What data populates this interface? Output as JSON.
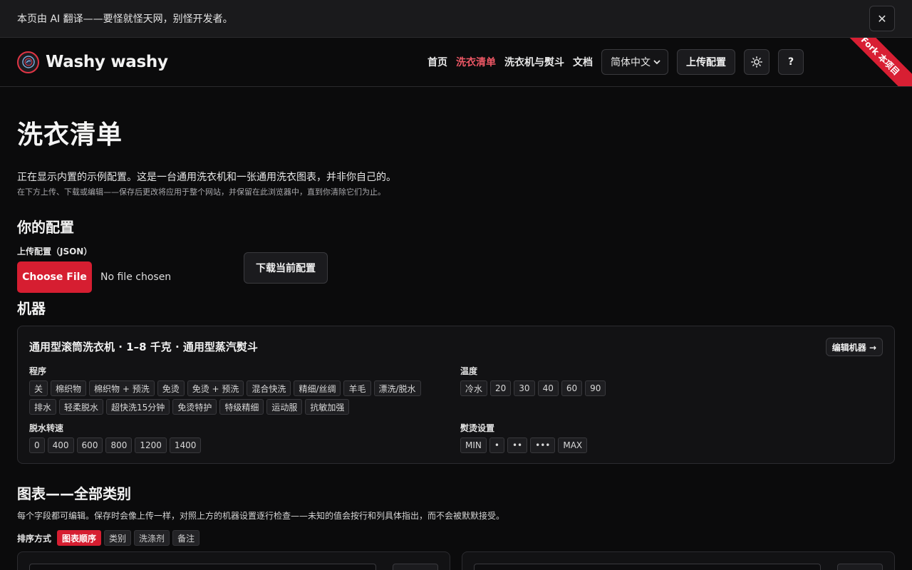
{
  "banner": {
    "text": "本页由 AI 翻译——要怪就怪天网，别怪开发者。",
    "close": "✕"
  },
  "nav": {
    "brand": "Washy washy",
    "links": [
      "首页",
      "洗衣清单",
      "洗衣机与熨斗",
      "文档"
    ],
    "active_link": "洗衣清单",
    "language": "简体中文",
    "upload_config": "上传配置",
    "help": "?",
    "ribbon": "Fork 本项目"
  },
  "page": {
    "title": "洗衣清单",
    "intro": "正在显示内置的示例配置。这是一台通用洗衣机和一张通用洗衣图表，并非你自己的。",
    "intro_sub": "在下方上传、下载或编辑——保存后更改将应用于整个网站，并保留在此浏览器中，直到你清除它们为止。"
  },
  "config": {
    "heading": "你的配置",
    "upload_label": "上传配置（JSON）",
    "choose_file": "Choose File",
    "no_file": "No file chosen",
    "download": "下载当前配置"
  },
  "machine": {
    "heading": "机器",
    "title": "通用型滚筒洗衣机 · 1–8 千克 · 通用型蒸汽熨斗",
    "edit": "编辑机器 →",
    "programs_label": "程序",
    "programs": [
      "关",
      "棉织物",
      "棉织物 + 预洗",
      "免烫",
      "免烫 + 预洗",
      "混合快洗",
      "精细/丝绸",
      "羊毛",
      "漂洗/脱水",
      "排水",
      "轻柔脱水",
      "超快洗15分钟",
      "免烫特护",
      "特级精细",
      "运动服",
      "抗敏加强"
    ],
    "temps_label": "温度",
    "temps": [
      "冷水",
      "20",
      "30",
      "40",
      "60",
      "90"
    ],
    "spin_label": "脱水转速",
    "spins": [
      "0",
      "400",
      "600",
      "800",
      "1200",
      "1400"
    ],
    "iron_label": "熨烫设置",
    "iron": [
      "MIN",
      "•",
      "••",
      "•••",
      "MAX"
    ]
  },
  "chart": {
    "heading": "图表——全部类别",
    "desc": "每个字段都可编辑。保存时会像上传一样，对照上方的机器设置逐行检查——未知的值会按行和列具体指出，而不会被默默接受。",
    "sort_label": "排序方式",
    "sort_options": [
      "图表顺序",
      "类别",
      "洗涤剂",
      "备注"
    ],
    "active_sort": "图表顺序"
  }
}
